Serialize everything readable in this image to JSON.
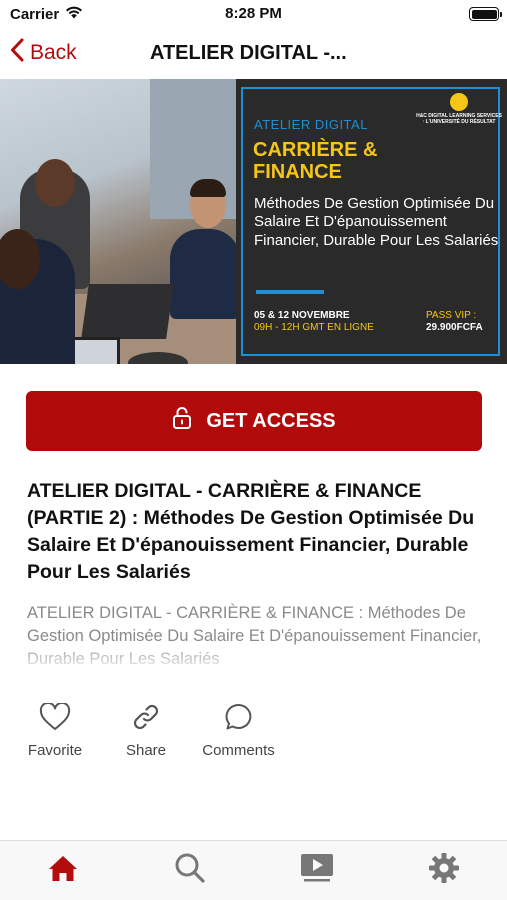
{
  "status_bar": {
    "carrier": "Carrier",
    "time": "8:28 PM"
  },
  "nav": {
    "back_label": "Back",
    "title": "ATELIER DIGITAL -..."
  },
  "hero": {
    "poster": {
      "logo_text": "H&C DIGITAL LEARNING SERVICES · L'UNIVERSITÉ DU RÉSULTAT",
      "kicker": "ATELIER DIGITAL",
      "heading_line1": "CARRIÈRE &",
      "heading_line2": "FINANCE",
      "body": "Méthodes De Gestion Optimisée Du Salaire Et D'épanouissement Financier, Durable Pour Les Salariés",
      "date_line1": "05 & 12 NOVEMBRE",
      "date_line2": "09H - 12H GMT EN LIGNE",
      "pass_label": "PASS VIP :",
      "pass_value": "29.900FCFA"
    }
  },
  "access_button": {
    "label": "GET ACCESS"
  },
  "course": {
    "title": "ATELIER DIGITAL - CARRIÈRE & FINANCE (PARTIE 2) : Méthodes De Gestion Optimisée Du Salaire Et D'épanouissement Financier, Durable Pour Les Salariés",
    "description": "ATELIER DIGITAL - CARRIÈRE & FINANCE : Méthodes De Gestion Optimisée Du Salaire Et D'épanouissement Financier, Durable Pour Les Salariés"
  },
  "actions": {
    "favorite": "Favorite",
    "share": "Share",
    "comments": "Comments"
  },
  "tabs": [
    {
      "icon": "home-icon",
      "active": true
    },
    {
      "icon": "search-icon",
      "active": false
    },
    {
      "icon": "video-icon",
      "active": false
    },
    {
      "icon": "gear-icon",
      "active": false
    }
  ],
  "colors": {
    "accent": "#b10a0a",
    "active_tab": "#b30c0c",
    "inactive_tab": "#777777",
    "poster_blue": "#1e8fd6",
    "poster_yellow": "#f5c518"
  }
}
